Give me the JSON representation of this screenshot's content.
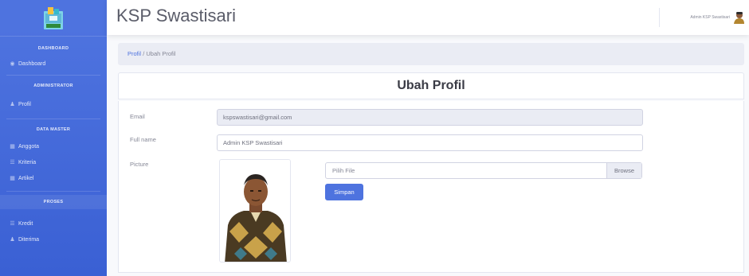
{
  "app": {
    "title": "KSP Swastisari"
  },
  "user": {
    "name": "Admin KSP Swastisari"
  },
  "sidebar": {
    "sections": [
      {
        "heading": "DASHBOARD",
        "items": [
          {
            "label": "Dashboard",
            "icon": "tachometer-icon"
          }
        ]
      },
      {
        "heading": "ADMINISTRATOR",
        "items": [
          {
            "label": "Profil",
            "icon": "user-icon"
          }
        ]
      },
      {
        "heading": "DATA MASTER",
        "items": [
          {
            "label": "Anggota",
            "icon": "table-icon"
          },
          {
            "label": "Kriteria",
            "icon": "list-icon"
          },
          {
            "label": "Artikel",
            "icon": "table-icon"
          }
        ]
      },
      {
        "heading": "PROSES",
        "items": [
          {
            "label": "Kredit",
            "icon": "list-icon"
          },
          {
            "label": "Diterima",
            "icon": "user-check-icon"
          }
        ]
      }
    ]
  },
  "breadcrumb": {
    "link": "Profil",
    "separator": "/",
    "current": "Ubah Profil"
  },
  "card": {
    "title": "Ubah Profil"
  },
  "form": {
    "email_label": "Email",
    "email_value": "kspswastisari@gmail.com",
    "fullname_label": "Full name",
    "fullname_value": "Admin KSP Swastisari",
    "picture_label": "Picture",
    "file_placeholder": "Pilih File",
    "browse_label": "Browse",
    "save_label": "Simpan"
  },
  "colors": {
    "primary": "#4e73df",
    "sidebar_bottom": "#3a60d4",
    "background": "#f8f9fc"
  }
}
